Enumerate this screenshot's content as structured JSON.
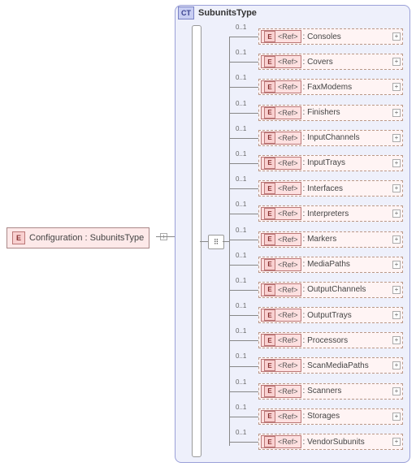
{
  "root": {
    "badge": "E",
    "label": "Configuration : SubunitsType"
  },
  "complexType": {
    "badge": "CT",
    "title": "SubunitsType"
  },
  "ref_label": "<Ref>",
  "occurrence": "0..1",
  "expand_glyph": "+",
  "element_badge": "E",
  "children": [
    {
      "name": "Consoles"
    },
    {
      "name": "Covers"
    },
    {
      "name": "FaxModems"
    },
    {
      "name": "Finishers"
    },
    {
      "name": "InputChannels"
    },
    {
      "name": "InputTrays"
    },
    {
      "name": "Interfaces"
    },
    {
      "name": "Interpreters"
    },
    {
      "name": "Markers"
    },
    {
      "name": "MediaPaths"
    },
    {
      "name": "OutputChannels"
    },
    {
      "name": "OutputTrays"
    },
    {
      "name": "Processors"
    },
    {
      "name": "ScanMediaPaths"
    },
    {
      "name": "Scanners"
    },
    {
      "name": "Storages"
    },
    {
      "name": "VendorSubunits"
    }
  ]
}
